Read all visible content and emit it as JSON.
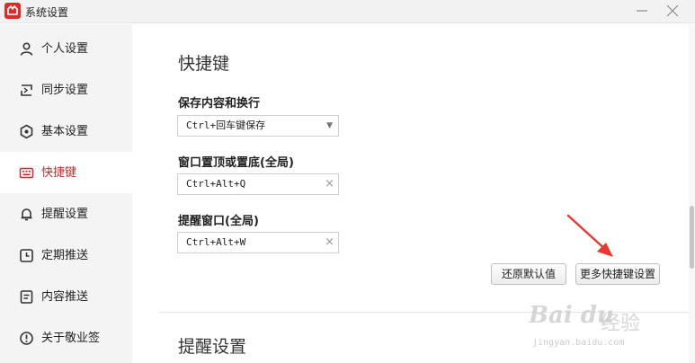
{
  "window": {
    "title": "系统设置"
  },
  "sidebar": {
    "items": [
      {
        "label": "个人设置",
        "icon": "user-icon"
      },
      {
        "label": "同步设置",
        "icon": "sync-icon"
      },
      {
        "label": "基本设置",
        "icon": "settings-icon"
      },
      {
        "label": "快捷键",
        "icon": "keyboard-icon",
        "active": true
      },
      {
        "label": "提醒设置",
        "icon": "bell-icon"
      },
      {
        "label": "定期推送",
        "icon": "clock-icon"
      },
      {
        "label": "内容推送",
        "icon": "document-icon"
      },
      {
        "label": "关于敬业签",
        "icon": "info-icon"
      }
    ]
  },
  "shortcuts": {
    "title": "快捷键",
    "save": {
      "label": "保存内容和换行",
      "value": "Ctrl+回车键保存"
    },
    "pin": {
      "label": "窗口置顶或置底(全局)",
      "value": "Ctrl+Alt+Q"
    },
    "remind": {
      "label": "提醒窗口(全局)",
      "value": "Ctrl+Alt+W"
    },
    "restore_label": "还原默认值",
    "more_label": "更多快捷键设置"
  },
  "reminder": {
    "title": "提醒设置"
  },
  "watermark": {
    "logo": "Bai du",
    "jingyan": "经验",
    "url": "jingyan.baidu.com"
  },
  "colors": {
    "accent": "#c62a2a",
    "app_icon": "#e02b2b",
    "arrow": "#e8382f"
  }
}
